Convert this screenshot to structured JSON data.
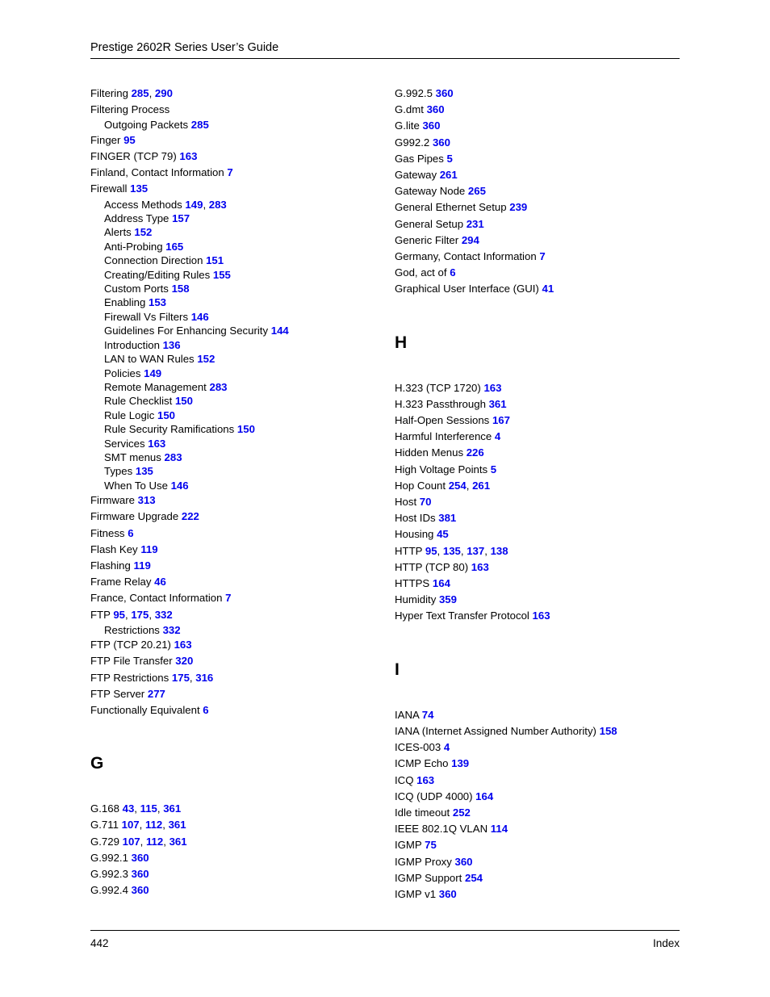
{
  "header": {
    "title": "Prestige 2602R Series User’s Guide"
  },
  "footer": {
    "page_number": "442",
    "section_label": "Index"
  },
  "colors": {
    "page_number_link": "#0000ee",
    "text": "#000000",
    "background": "#ffffff"
  },
  "columns": {
    "left": {
      "blocks": [
        {
          "type": "entries",
          "entries": [
            {
              "term": "Filtering",
              "pages": [
                "285",
                "290"
              ],
              "level": 0
            },
            {
              "term": "Filtering Process",
              "pages": [],
              "level": 0
            },
            {
              "term": "Outgoing Packets",
              "pages": [
                "285"
              ],
              "level": 1
            },
            {
              "term": "Finger",
              "pages": [
                "95"
              ],
              "level": 0
            },
            {
              "term": "FINGER (TCP 79)",
              "pages": [
                "163"
              ],
              "level": 0
            },
            {
              "term": "Finland, Contact Information",
              "pages": [
                "7"
              ],
              "level": 0
            },
            {
              "term": "Firewall",
              "pages": [
                "135"
              ],
              "level": 0
            },
            {
              "term": "Access Methods",
              "pages": [
                "149",
                "283"
              ],
              "level": 1
            },
            {
              "term": "Address Type",
              "pages": [
                "157"
              ],
              "level": 1
            },
            {
              "term": "Alerts",
              "pages": [
                "152"
              ],
              "level": 1
            },
            {
              "term": "Anti-Probing",
              "pages": [
                "165"
              ],
              "level": 1
            },
            {
              "term": "Connection Direction",
              "pages": [
                "151"
              ],
              "level": 1
            },
            {
              "term": "Creating/Editing Rules",
              "pages": [
                "155"
              ],
              "level": 1
            },
            {
              "term": "Custom Ports",
              "pages": [
                "158"
              ],
              "level": 1
            },
            {
              "term": "Enabling",
              "pages": [
                "153"
              ],
              "level": 1
            },
            {
              "term": "Firewall Vs Filters",
              "pages": [
                "146"
              ],
              "level": 1
            },
            {
              "term": "Guidelines For Enhancing Security",
              "pages": [
                "144"
              ],
              "level": 1
            },
            {
              "term": "Introduction",
              "pages": [
                "136"
              ],
              "level": 1
            },
            {
              "term": "LAN to WAN Rules",
              "pages": [
                "152"
              ],
              "level": 1
            },
            {
              "term": "Policies",
              "pages": [
                "149"
              ],
              "level": 1
            },
            {
              "term": "Remote Management",
              "pages": [
                "283"
              ],
              "level": 1
            },
            {
              "term": "Rule Checklist",
              "pages": [
                "150"
              ],
              "level": 1
            },
            {
              "term": "Rule Logic",
              "pages": [
                "150"
              ],
              "level": 1
            },
            {
              "term": "Rule Security Ramifications",
              "pages": [
                "150"
              ],
              "level": 1
            },
            {
              "term": "Services",
              "pages": [
                "163"
              ],
              "level": 1
            },
            {
              "term": "SMT menus",
              "pages": [
                "283"
              ],
              "level": 1
            },
            {
              "term": "Types",
              "pages": [
                "135"
              ],
              "level": 1
            },
            {
              "term": "When To Use",
              "pages": [
                "146"
              ],
              "level": 1
            },
            {
              "term": "Firmware",
              "pages": [
                "313"
              ],
              "level": 0
            },
            {
              "term": "Firmware Upgrade",
              "pages": [
                "222"
              ],
              "level": 0
            },
            {
              "term": "Fitness",
              "pages": [
                "6"
              ],
              "level": 0
            },
            {
              "term": "Flash Key",
              "pages": [
                "119"
              ],
              "level": 0
            },
            {
              "term": "Flashing",
              "pages": [
                "119"
              ],
              "level": 0
            },
            {
              "term": "Frame Relay",
              "pages": [
                "46"
              ],
              "level": 0
            },
            {
              "term": "France, Contact Information",
              "pages": [
                "7"
              ],
              "level": 0
            },
            {
              "term": "FTP",
              "pages": [
                "95",
                "175",
                "332"
              ],
              "level": 0
            },
            {
              "term": "Restrictions",
              "pages": [
                "332"
              ],
              "level": 1
            },
            {
              "term": "FTP (TCP 20.21)",
              "pages": [
                "163"
              ],
              "level": 0
            },
            {
              "term": "FTP File Transfer",
              "pages": [
                "320"
              ],
              "level": 0
            },
            {
              "term": "FTP Restrictions",
              "pages": [
                "175",
                "316"
              ],
              "level": 0
            },
            {
              "term": "FTP Server",
              "pages": [
                "277"
              ],
              "level": 0
            },
            {
              "term": "Functionally Equivalent",
              "pages": [
                "6"
              ],
              "level": 0
            }
          ]
        },
        {
          "type": "letter",
          "letter": "G"
        },
        {
          "type": "entries",
          "entries": [
            {
              "term": "G.168",
              "pages": [
                "43",
                "115",
                "361"
              ],
              "level": 0
            },
            {
              "term": "G.711",
              "pages": [
                "107",
                "112",
                "361"
              ],
              "level": 0
            },
            {
              "term": "G.729",
              "pages": [
                "107",
                "112",
                "361"
              ],
              "level": 0
            },
            {
              "term": "G.992.1",
              "pages": [
                "360"
              ],
              "level": 0
            },
            {
              "term": "G.992.3",
              "pages": [
                "360"
              ],
              "level": 0
            },
            {
              "term": "G.992.4",
              "pages": [
                "360"
              ],
              "level": 0
            }
          ]
        }
      ]
    },
    "right": {
      "blocks": [
        {
          "type": "entries",
          "entries": [
            {
              "term": "G.992.5",
              "pages": [
                "360"
              ],
              "level": 0
            },
            {
              "term": "G.dmt",
              "pages": [
                "360"
              ],
              "level": 0
            },
            {
              "term": "G.lite",
              "pages": [
                "360"
              ],
              "level": 0
            },
            {
              "term": "G992.2",
              "pages": [
                "360"
              ],
              "level": 0
            },
            {
              "term": "Gas Pipes",
              "pages": [
                "5"
              ],
              "level": 0
            },
            {
              "term": "Gateway",
              "pages": [
                "261"
              ],
              "level": 0
            },
            {
              "term": "Gateway Node",
              "pages": [
                "265"
              ],
              "level": 0
            },
            {
              "term": "General Ethernet Setup",
              "pages": [
                "239"
              ],
              "level": 0
            },
            {
              "term": "General Setup",
              "pages": [
                "231"
              ],
              "level": 0
            },
            {
              "term": "Generic Filter",
              "pages": [
                "294"
              ],
              "level": 0
            },
            {
              "term": "Germany, Contact Information",
              "pages": [
                "7"
              ],
              "level": 0
            },
            {
              "term": "God, act of",
              "pages": [
                "6"
              ],
              "level": 0
            },
            {
              "term": "Graphical User Interface (GUI)",
              "pages": [
                "41"
              ],
              "level": 0
            }
          ]
        },
        {
          "type": "letter",
          "letter": "H"
        },
        {
          "type": "entries",
          "entries": [
            {
              "term": "H.323 (TCP 1720)",
              "pages": [
                "163"
              ],
              "level": 0
            },
            {
              "term": "H.323 Passthrough",
              "pages": [
                "361"
              ],
              "level": 0
            },
            {
              "term": "Half-Open Sessions",
              "pages": [
                "167"
              ],
              "level": 0
            },
            {
              "term": "Harmful Interference",
              "pages": [
                "4"
              ],
              "level": 0
            },
            {
              "term": "Hidden Menus",
              "pages": [
                "226"
              ],
              "level": 0
            },
            {
              "term": "High Voltage Points",
              "pages": [
                "5"
              ],
              "level": 0
            },
            {
              "term": "Hop Count",
              "pages": [
                "254",
                "261"
              ],
              "level": 0
            },
            {
              "term": "Host",
              "pages": [
                "70"
              ],
              "level": 0
            },
            {
              "term": "Host IDs",
              "pages": [
                "381"
              ],
              "level": 0
            },
            {
              "term": "Housing",
              "pages": [
                "45"
              ],
              "level": 0
            },
            {
              "term": "HTTP",
              "pages": [
                "95",
                "135",
                "137",
                "138"
              ],
              "level": 0
            },
            {
              "term": "HTTP (TCP 80)",
              "pages": [
                "163"
              ],
              "level": 0
            },
            {
              "term": "HTTPS",
              "pages": [
                "164"
              ],
              "level": 0
            },
            {
              "term": "Humidity",
              "pages": [
                "359"
              ],
              "level": 0
            },
            {
              "term": "Hyper Text Transfer Protocol",
              "pages": [
                "163"
              ],
              "level": 0
            }
          ]
        },
        {
          "type": "letter",
          "letter": "I"
        },
        {
          "type": "entries",
          "entries": [
            {
              "term": "IANA",
              "pages": [
                "74"
              ],
              "level": 0
            },
            {
              "term": "IANA (Internet Assigned Number Authority)",
              "pages": [
                "158"
              ],
              "level": 0
            },
            {
              "term": "ICES-003",
              "pages": [
                "4"
              ],
              "level": 0
            },
            {
              "term": "ICMP Echo",
              "pages": [
                "139"
              ],
              "level": 0
            },
            {
              "term": "ICQ",
              "pages": [
                "163"
              ],
              "level": 0
            },
            {
              "term": "ICQ (UDP 4000)",
              "pages": [
                "164"
              ],
              "level": 0
            },
            {
              "term": "Idle timeout",
              "pages": [
                "252"
              ],
              "level": 0
            },
            {
              "term": "IEEE 802.1Q VLAN",
              "pages": [
                "114"
              ],
              "level": 0
            },
            {
              "term": "IGMP",
              "pages": [
                "75"
              ],
              "level": 0
            },
            {
              "term": "IGMP Proxy",
              "pages": [
                "360"
              ],
              "level": 0
            },
            {
              "term": "IGMP Support",
              "pages": [
                "254"
              ],
              "level": 0
            },
            {
              "term": "IGMP v1",
              "pages": [
                "360"
              ],
              "level": 0
            }
          ]
        }
      ]
    }
  }
}
